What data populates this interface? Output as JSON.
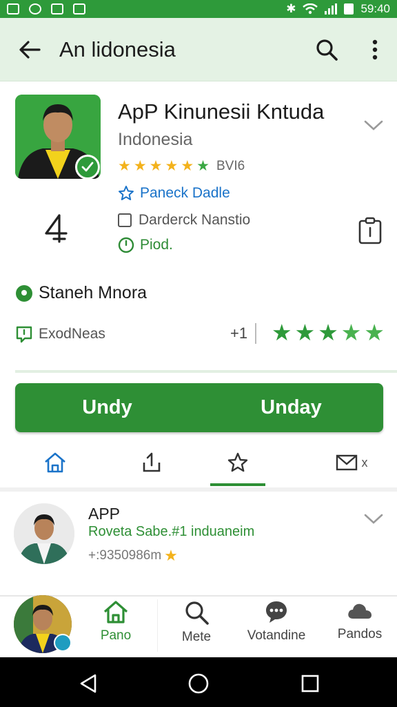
{
  "status_bar": {
    "time": "59:40"
  },
  "app_bar": {
    "title": "An lidonesia"
  },
  "app": {
    "name": "ApP Kinunesii Kntuda",
    "country": "Indonesia",
    "rating_text": "BVI6",
    "badge_label": "Paneck Dadle",
    "checkbox_label": "Darderck Nanstio",
    "status_label": "Piod.",
    "age_rating": "4"
  },
  "location": {
    "label": "Staneh Mnora"
  },
  "reviews": {
    "label": "ExodNeas",
    "count": "+1",
    "stars": 5
  },
  "install": {
    "button1": "Undy",
    "button2": "Unday"
  },
  "action_tabs": {
    "share_tab_suffix": "x"
  },
  "developer": {
    "name": "APP",
    "subtitle": "Roveta Sabe.#1 induaneim",
    "meta_text": "+:9350986m"
  },
  "bottom_nav": {
    "items": [
      {
        "label": "Pano"
      },
      {
        "label": "Mete"
      },
      {
        "label": "Votandine"
      },
      {
        "label": "Pandos"
      }
    ]
  },
  "colors": {
    "brand_green": "#2e8f35",
    "star_yellow": "#f3b21c",
    "link_blue": "#1a73c9"
  }
}
